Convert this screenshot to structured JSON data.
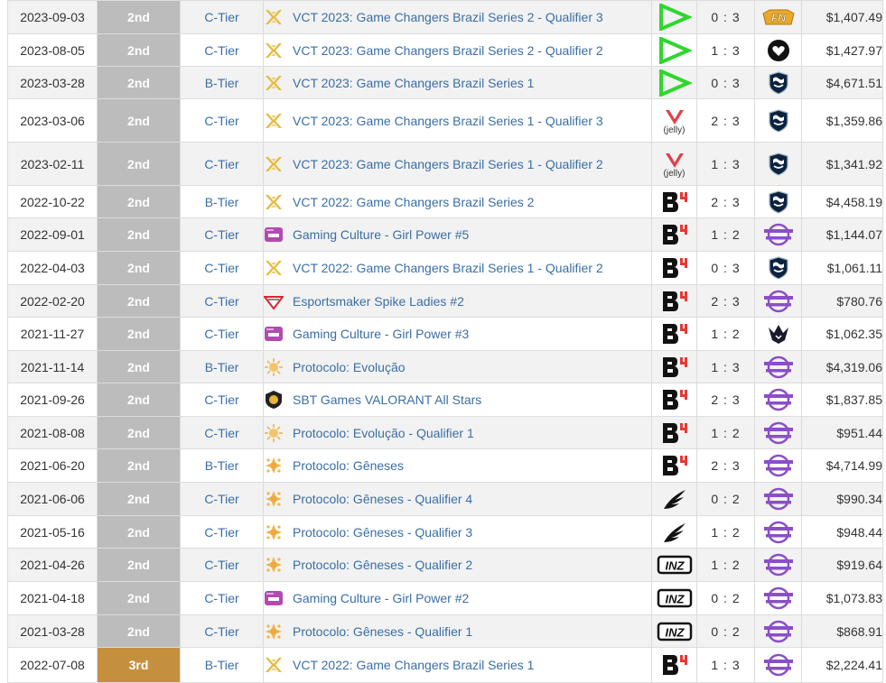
{
  "rows": [
    {
      "date": "2023-09-03",
      "place": "2nd",
      "tier": "C-Tier",
      "tournament": "VCT 2023: Game Changers Brazil Series 2 - Qualifier 3",
      "tournament_icon": "vct-icon",
      "team_icon": "lev-team-icon",
      "team_label": "",
      "score": "0 : 3",
      "opponent_icon": "fn-team-icon",
      "opponent_label": "FN",
      "prize": "$1,407.49"
    },
    {
      "date": "2023-08-05",
      "place": "2nd",
      "tier": "C-Tier",
      "tournament": "VCT 2023: Game Changers Brazil Series 2 - Qualifier 2",
      "tournament_icon": "vct-icon",
      "team_icon": "lev-team-icon",
      "team_label": "",
      "score": "1 : 3",
      "opponent_icon": "heart-team-icon",
      "opponent_label": "",
      "prize": "$1,427.97"
    },
    {
      "date": "2023-03-28",
      "place": "2nd",
      "tier": "B-Tier",
      "tournament": "VCT 2023: Game Changers Brazil Series 1",
      "tournament_icon": "vct-icon",
      "team_icon": "lev-team-icon",
      "team_label": "",
      "score": "0 : 3",
      "opponent_icon": "liquid-team-icon",
      "opponent_label": "",
      "prize": "$4,671.51"
    },
    {
      "date": "2023-03-06",
      "place": "2nd",
      "tier": "C-Tier",
      "tournament": "VCT 2023: Game Changers Brazil Series 1 - Qualifier 3",
      "tournament_icon": "vct-icon",
      "team_icon": "jelly-team-icon",
      "team_label": "(jelly)",
      "score": "2 : 3",
      "opponent_icon": "liquid-team-icon",
      "opponent_label": "",
      "prize": "$1,359.86"
    },
    {
      "date": "2023-02-11",
      "place": "2nd",
      "tier": "C-Tier",
      "tournament": "VCT 2023: Game Changers Brazil Series 1 - Qualifier 2",
      "tournament_icon": "vct-icon",
      "team_icon": "jelly-team-icon",
      "team_label": "(jelly)",
      "score": "1 : 3",
      "opponent_icon": "liquid-team-icon",
      "opponent_label": "",
      "prize": "$1,341.92"
    },
    {
      "date": "2022-10-22",
      "place": "2nd",
      "tier": "B-Tier",
      "tournament": "VCT 2022: Game Changers Brazil Series 2",
      "tournament_icon": "vct-icon",
      "team_icon": "b4-team-icon",
      "team_label": "",
      "score": "2 : 3",
      "opponent_icon": "liquid-team-icon",
      "opponent_label": "",
      "prize": "$4,458.19"
    },
    {
      "date": "2022-09-01",
      "place": "2nd",
      "tier": "C-Tier",
      "tournament": "Gaming Culture - Girl Power #5",
      "tournament_icon": "gaming-culture-icon",
      "team_icon": "b4-team-icon",
      "team_label": "",
      "score": "1 : 2",
      "opponent_icon": "purple-team-icon",
      "opponent_label": "",
      "prize": "$1,144.07"
    },
    {
      "date": "2022-04-03",
      "place": "2nd",
      "tier": "C-Tier",
      "tournament": "VCT 2022: Game Changers Brazil Series 1 - Qualifier 2",
      "tournament_icon": "vct-icon",
      "team_icon": "b4-team-icon",
      "team_label": "",
      "score": "0 : 3",
      "opponent_icon": "liquid-team-icon",
      "opponent_label": "",
      "prize": "$1,061.11"
    },
    {
      "date": "2022-02-20",
      "place": "2nd",
      "tier": "C-Tier",
      "tournament": "Esportsmaker Spike Ladies #2",
      "tournament_icon": "spike-ladies-icon",
      "team_icon": "b4-team-icon",
      "team_label": "",
      "score": "2 : 3",
      "opponent_icon": "purple-team-icon",
      "opponent_label": "",
      "prize": "$780.76"
    },
    {
      "date": "2021-11-27",
      "place": "2nd",
      "tier": "C-Tier",
      "tournament": "Gaming Culture - Girl Power #3",
      "tournament_icon": "gaming-culture-icon",
      "team_icon": "b4-team-icon",
      "team_label": "",
      "score": "1 : 2",
      "opponent_icon": "crown-team-icon",
      "opponent_label": "",
      "prize": "$1,062.35"
    },
    {
      "date": "2021-11-14",
      "place": "2nd",
      "tier": "B-Tier",
      "tournament": "Protocolo: Evolução",
      "tournament_icon": "protocolo-evolucao-icon",
      "team_icon": "b4-team-icon",
      "team_label": "",
      "score": "1 : 3",
      "opponent_icon": "purple-team-icon",
      "opponent_label": "",
      "prize": "$4,319.06"
    },
    {
      "date": "2021-09-26",
      "place": "2nd",
      "tier": "C-Tier",
      "tournament": "SBT Games VALORANT All Stars",
      "tournament_icon": "sbt-games-icon",
      "team_icon": "b4-team-icon",
      "team_label": "",
      "score": "2 : 3",
      "opponent_icon": "purple-team-icon",
      "opponent_label": "",
      "prize": "$1,837.85"
    },
    {
      "date": "2021-08-08",
      "place": "2nd",
      "tier": "C-Tier",
      "tournament": "Protocolo: Evolução - Qualifier 1",
      "tournament_icon": "protocolo-evolucao-icon",
      "team_icon": "b4-team-icon",
      "team_label": "",
      "score": "1 : 2",
      "opponent_icon": "purple-team-icon",
      "opponent_label": "",
      "prize": "$951.44"
    },
    {
      "date": "2021-06-20",
      "place": "2nd",
      "tier": "B-Tier",
      "tournament": "Protocolo: Gêneses",
      "tournament_icon": "protocolo-geneses-icon",
      "team_icon": "b4-team-icon",
      "team_label": "",
      "score": "2 : 3",
      "opponent_icon": "purple-team-icon",
      "opponent_label": "",
      "prize": "$4,714.99"
    },
    {
      "date": "2021-06-06",
      "place": "2nd",
      "tier": "C-Tier",
      "tournament": "Protocolo: Gêneses - Qualifier 4",
      "tournament_icon": "protocolo-geneses-icon",
      "team_icon": "wing-team-icon",
      "team_label": "",
      "score": "0 : 2",
      "opponent_icon": "purple-team-icon",
      "opponent_label": "",
      "prize": "$990.34"
    },
    {
      "date": "2021-05-16",
      "place": "2nd",
      "tier": "C-Tier",
      "tournament": "Protocolo: Gêneses - Qualifier 3",
      "tournament_icon": "protocolo-geneses-icon",
      "team_icon": "wing-team-icon",
      "team_label": "",
      "score": "1 : 2",
      "opponent_icon": "purple-team-icon",
      "opponent_label": "",
      "prize": "$948.44"
    },
    {
      "date": "2021-04-26",
      "place": "2nd",
      "tier": "C-Tier",
      "tournament": "Protocolo: Gêneses - Qualifier 2",
      "tournament_icon": "protocolo-geneses-icon",
      "team_icon": "inz-team-icon",
      "team_label": "INZ",
      "score": "1 : 2",
      "opponent_icon": "purple-team-icon",
      "opponent_label": "",
      "prize": "$919.64"
    },
    {
      "date": "2021-04-18",
      "place": "2nd",
      "tier": "C-Tier",
      "tournament": "Gaming Culture - Girl Power #2",
      "tournament_icon": "gaming-culture-icon",
      "team_icon": "inz-team-icon",
      "team_label": "INZ",
      "score": "0 : 2",
      "opponent_icon": "purple-team-icon",
      "opponent_label": "",
      "prize": "$1,073.83"
    },
    {
      "date": "2021-03-28",
      "place": "2nd",
      "tier": "C-Tier",
      "tournament": "Protocolo: Gêneses - Qualifier 1",
      "tournament_icon": "protocolo-geneses-icon",
      "team_icon": "inz-team-icon",
      "team_label": "INZ",
      "score": "0 : 2",
      "opponent_icon": "purple-team-icon",
      "opponent_label": "",
      "prize": "$868.91"
    },
    {
      "date": "2022-07-08",
      "place": "3rd",
      "tier": "B-Tier",
      "tournament": "VCT 2022: Game Changers Brazil Series 1",
      "tournament_icon": "vct-icon",
      "team_icon": "b4-team-icon",
      "team_label": "",
      "score": "1 : 3",
      "opponent_icon": "purple-team-icon",
      "opponent_label": "",
      "prize": "$2,224.41"
    }
  ],
  "colors": {
    "link": "#3a6ea5",
    "second_place_bg": "#bcbcbc",
    "third_place_bg": "#c5903e",
    "row_alt_bg": "#f2f2f2",
    "vct_gold": "#e6b83c",
    "lev_green": "#2fd62f",
    "jelly_red": "#e0404a",
    "purple": "#8a4fc7"
  }
}
